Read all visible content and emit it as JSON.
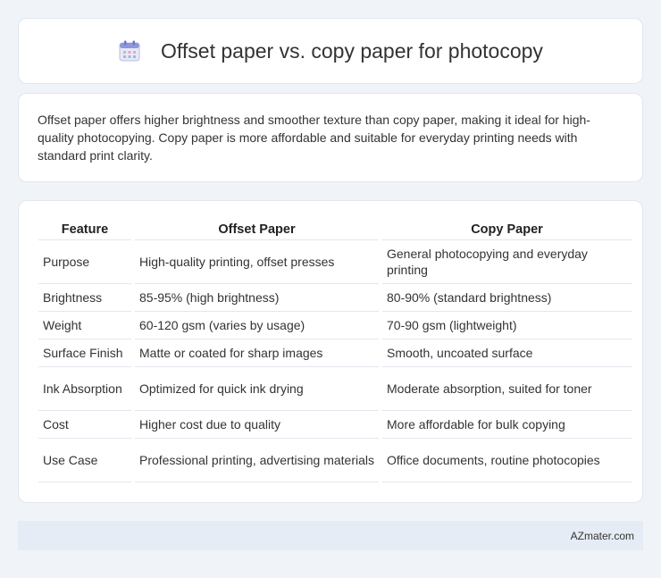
{
  "header": {
    "title": "Offset paper vs. copy paper for photocopy",
    "icon": "calendar-icon"
  },
  "summary": {
    "text": "Offset paper offers higher brightness and smoother texture than copy paper, making it ideal for high-quality photocopying. Copy paper is more affordable and suitable for everyday printing needs with standard print clarity."
  },
  "table": {
    "headers": [
      "Feature",
      "Offset Paper",
      "Copy Paper"
    ],
    "rows": [
      [
        "Purpose",
        "High-quality printing, offset presses",
        "General photocopying and everyday printing"
      ],
      [
        "Brightness",
        "85-95% (high brightness)",
        "80-90% (standard brightness)"
      ],
      [
        "Weight",
        "60-120 gsm (varies by usage)",
        "70-90 gsm (lightweight)"
      ],
      [
        "Surface Finish",
        "Matte or coated for sharp images",
        "Smooth, uncoated surface"
      ],
      [
        "Ink Absorption",
        "Optimized for quick ink drying",
        "Moderate absorption, suited for toner"
      ],
      [
        "Cost",
        "Higher cost due to quality",
        "More affordable for bulk copying"
      ],
      [
        "Use Case",
        "Professional printing, advertising materials",
        "Office documents, routine photocopies"
      ]
    ]
  },
  "footer": {
    "text": "AZmater.com"
  }
}
